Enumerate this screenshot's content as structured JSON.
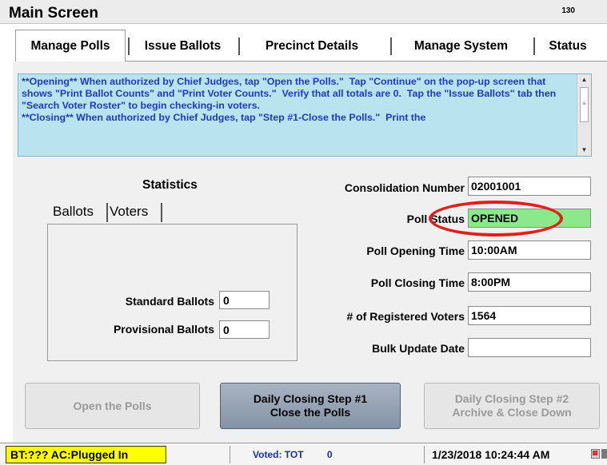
{
  "window": {
    "title": "Main Screen",
    "code": "130"
  },
  "tabs": [
    {
      "label": "Manage Polls",
      "active": true
    },
    {
      "label": "Issue Ballots",
      "active": false
    },
    {
      "label": "Precinct Details",
      "active": false
    },
    {
      "label": "Manage System",
      "active": false
    },
    {
      "label": "Status",
      "active": false
    }
  ],
  "instructions": {
    "text": "**Opening** When authorized by Chief Judges, tap \"Open the Polls.\"  Tap \"Continue\" on the pop-up screen that shows \"Print Ballot Counts\" and \"Print Voter Counts.\"  Verify that all totals are 0.  Tap the \"Issue Ballots\" tab then \"Search Voter Roster\" to begin checking-in voters.\n**Closing** When authorized by Chief Judges, tap \"Step #1-Close the Polls.\"  Print the",
    "text_color": "#1f3ac6",
    "background": "#b9e3ef"
  },
  "statistics": {
    "title": "Statistics",
    "tabs": [
      {
        "label": "Ballots"
      },
      {
        "label": "Voters"
      }
    ],
    "standard_ballots_label": "Standard Ballots",
    "standard_ballots_value": "0",
    "provisional_ballots_label": "Provisional Ballots",
    "provisional_ballots_value": "0"
  },
  "details": {
    "consolidation_label": "Consolidation Number",
    "consolidation_value": "02001001",
    "poll_status_label": "Poll Status",
    "poll_status_value": "OPENED",
    "poll_status_color": "#8be98b",
    "opening_time_label": "Poll Opening Time",
    "opening_time_value": "10:00AM",
    "closing_time_label": "Poll Closing Time",
    "closing_time_value": "8:00PM",
    "registered_voters_label": "# of Registered Voters",
    "registered_voters_value": "1564",
    "bulk_update_label": "Bulk Update Date",
    "bulk_update_value": ""
  },
  "annotation": {
    "shape": "ellipse",
    "color": "#e0201c"
  },
  "buttons": {
    "open_polls": "Open the Polls",
    "close_step1_line1": "Daily Closing Step #1",
    "close_step1_line2": "Close the Polls",
    "close_step2_line1": "Daily Closing Step #2",
    "close_step2_line2": "Archive & Close Down"
  },
  "status_bar": {
    "battery": "BT:??? AC:Plugged In",
    "battery_color": "#ffff00",
    "voted_label": "Voted:",
    "voted_unit": "TOT",
    "voted_count": "0",
    "datetime": "1/23/2018 10:24:44 AM",
    "icons": [
      "network-status-icon",
      "tray-icon"
    ]
  }
}
